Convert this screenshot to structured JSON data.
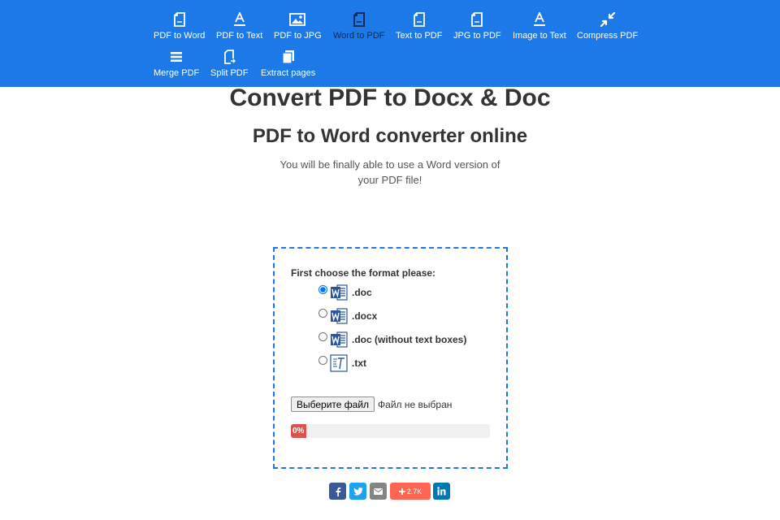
{
  "nav": {
    "items": [
      {
        "label": "PDF to Word",
        "icon": "file-icon"
      },
      {
        "label": "PDF to Text",
        "icon": "text-a-icon"
      },
      {
        "label": "PDF to JPG",
        "icon": "image-icon"
      },
      {
        "label": "Word to PDF",
        "icon": "file-icon",
        "active": true
      },
      {
        "label": "Text to PDF",
        "icon": "file-icon"
      },
      {
        "label": "JPG to PDF",
        "icon": "file-icon"
      },
      {
        "label": "Image to Text",
        "icon": "text-a-icon"
      },
      {
        "label": "Compress PDF",
        "icon": "compress-icon"
      },
      {
        "label": "Merge PDF",
        "icon": "merge-icon"
      },
      {
        "label": "Split PDF",
        "icon": "split-icon"
      },
      {
        "label": "Extract pages",
        "icon": "pages-icon"
      }
    ]
  },
  "heading": {
    "title": "Convert PDF to Docx & Doc",
    "subtitle": "PDF to Word converter online",
    "description": "You will be finally able to use a Word version of your PDF file!"
  },
  "converter": {
    "prompt": "First choose the format please:",
    "options": [
      {
        "label": ".doc",
        "icon": "word-icon",
        "selected": true
      },
      {
        "label": ".docx",
        "icon": "word-icon",
        "selected": false
      },
      {
        "label": ".doc (without text boxes)",
        "icon": "word-icon",
        "selected": false
      },
      {
        "label": ".txt",
        "icon": "txt-icon",
        "selected": false
      }
    ],
    "file_button": "Выберите файл",
    "file_status": "Файл не выбран",
    "progress": {
      "percent": 0,
      "label": "0%"
    }
  },
  "share": {
    "facebook_color": "#3b5998",
    "twitter_color": "#1da1f2",
    "email_color": "#848484",
    "more_color": "#ff6550",
    "more_count": "2.7K",
    "linkedin_color": "#0077b5"
  },
  "colors": {
    "nav_bg": "#1e79e8",
    "box_border": "#1e79e8",
    "progress_fill": "#d9534f",
    "word_blue": "#2b579a"
  }
}
